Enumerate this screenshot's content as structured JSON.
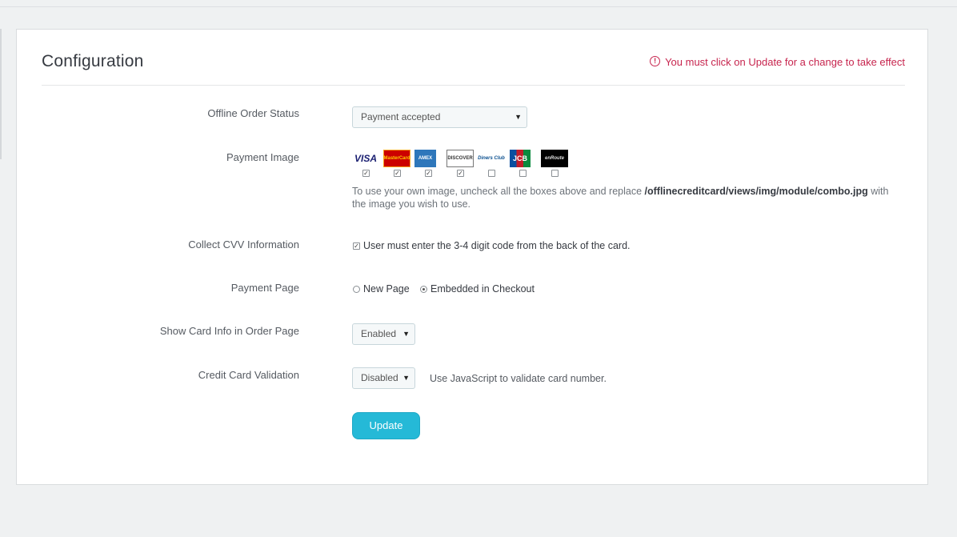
{
  "title": "Configuration",
  "warning": "You must click on Update for a change to take effect",
  "fields": {
    "offline_order_status": {
      "label": "Offline Order Status",
      "value": "Payment accepted"
    },
    "payment_image": {
      "label": "Payment Image",
      "cards": [
        {
          "name": "VISA",
          "checked": true
        },
        {
          "name": "MasterCard",
          "checked": true
        },
        {
          "name": "American Express",
          "checked": true
        },
        {
          "name": "DISCOVER",
          "checked": true
        },
        {
          "name": "Diners Club",
          "checked": false
        },
        {
          "name": "JCB",
          "checked": false
        },
        {
          "name": "enRoute",
          "checked": false
        }
      ],
      "help_prefix": "To use your own image, uncheck all the boxes above and replace ",
      "help_path": "/offlinecreditcard/views/img/module/combo.jpg",
      "help_suffix": " with the image you wish to use."
    },
    "collect_cvv": {
      "label": "Collect CVV Information",
      "checkbox_label": "User must enter the 3-4 digit code from the back of the card.",
      "checked": true
    },
    "payment_page": {
      "label": "Payment Page",
      "options": [
        "New Page",
        "Embedded in Checkout"
      ],
      "selected": "Embedded in Checkout"
    },
    "show_card_info": {
      "label": "Show Card Info in Order Page",
      "value": "Enabled"
    },
    "cc_validation": {
      "label": "Credit Card Validation",
      "value": "Disabled",
      "help": "Use JavaScript to validate card number."
    }
  },
  "update_button": "Update",
  "colors": {
    "accent": "#25b9d7",
    "warning": "#c7254e"
  }
}
